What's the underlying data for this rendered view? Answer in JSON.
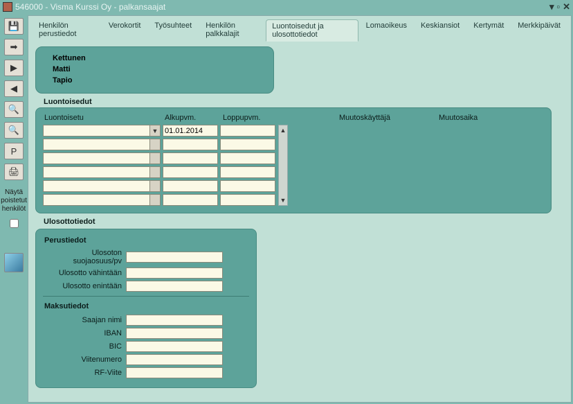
{
  "window": {
    "title": "546000 - Visma Kurssi Oy - palkansaajat"
  },
  "sidebar": {
    "show_deleted_label": "Näytä poistetut henkilöt",
    "buttons": {
      "save": "💾",
      "exit": "➡",
      "next": "▶",
      "prev": "◀",
      "search": "🔍",
      "zoom": "🔍",
      "p": "P",
      "print": "🖨"
    }
  },
  "tabs": [
    "Henkilön perustiedot",
    "Verokortit",
    "Työsuhteet",
    "Henkilön palkkalajit",
    "Luontoisedut ja ulosottotiedot",
    "Lomaoikeus",
    "Keskiansiot",
    "Kertymät",
    "Merkkipäivät"
  ],
  "active_tab_index": 4,
  "person": {
    "lastname": "Kettunen",
    "firstname": "Matti",
    "middlename": "Tapio"
  },
  "luontoisedut": {
    "title": "Luontoisedut",
    "headers": {
      "benefit": "Luontoisetu",
      "start": "Alkupvm.",
      "end": "Loppupvm.",
      "user": "Muutoskäyttäjä",
      "time": "Muutosaika"
    },
    "rows": [
      {
        "benefit": "",
        "start": "01.01.2014",
        "end": ""
      },
      {
        "benefit": "",
        "start": "",
        "end": ""
      },
      {
        "benefit": "",
        "start": "",
        "end": ""
      },
      {
        "benefit": "",
        "start": "",
        "end": ""
      },
      {
        "benefit": "",
        "start": "",
        "end": ""
      },
      {
        "benefit": "",
        "start": "",
        "end": ""
      }
    ]
  },
  "ulosotto": {
    "title": "Ulosottotiedot",
    "perustiedot": {
      "title": "Perustiedot",
      "suojaosuus_label": "Ulosoton suojaosuus/pv",
      "vahintaan_label": "Ulosotto vähintään",
      "enintaan_label": "Ulosotto enintään",
      "suojaosuus": "",
      "vahintaan": "",
      "enintaan": ""
    },
    "maksutiedot": {
      "title": "Maksutiedot",
      "saaja_label": "Saajan nimi",
      "iban_label": "IBAN",
      "bic_label": "BIC",
      "viite_label": "Viitenumero",
      "rfviite_label": "RF-Viite",
      "saaja": "",
      "iban": "",
      "bic": "",
      "viite": "",
      "rfviite": ""
    }
  }
}
